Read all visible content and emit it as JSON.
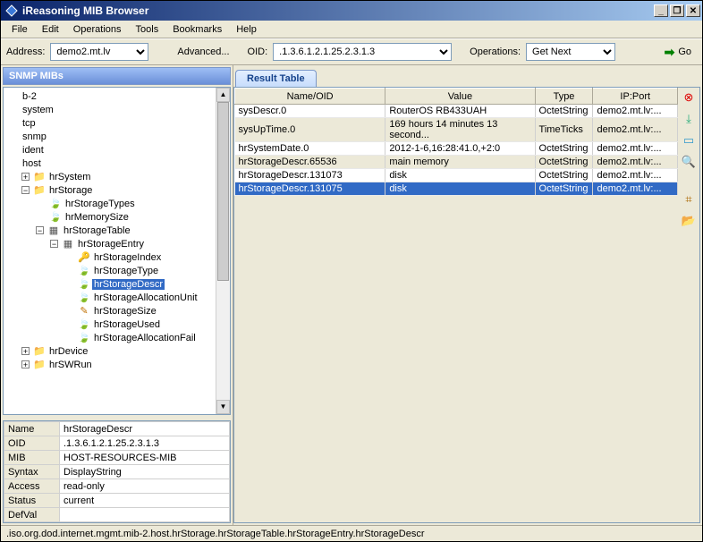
{
  "window": {
    "title": "iReasoning MIB Browser"
  },
  "menu": [
    "File",
    "Edit",
    "Operations",
    "Tools",
    "Bookmarks",
    "Help"
  ],
  "toolbar": {
    "address_label": "Address:",
    "address_value": "demo2.mt.lv",
    "advanced_label": "Advanced...",
    "oid_label": "OID:",
    "oid_value": ".1.3.6.1.2.1.25.2.3.1.3",
    "operations_label": "Operations:",
    "operations_value": "Get Next",
    "go_label": "Go"
  },
  "left": {
    "header": "SNMP MIBs",
    "tree": [
      {
        "depth": 0,
        "exp": "",
        "icon": "",
        "label": "b-2"
      },
      {
        "depth": 0,
        "exp": "",
        "icon": "",
        "label": "system"
      },
      {
        "depth": 0,
        "exp": "",
        "icon": "",
        "label": "tcp"
      },
      {
        "depth": 0,
        "exp": "",
        "icon": "",
        "label": "snmp"
      },
      {
        "depth": 0,
        "exp": "",
        "icon": "",
        "label": "ident"
      },
      {
        "depth": 0,
        "exp": "",
        "icon": "",
        "label": "host"
      },
      {
        "depth": 1,
        "exp": "+",
        "icon": "folder",
        "label": "hrSystem"
      },
      {
        "depth": 1,
        "exp": "-",
        "icon": "folder",
        "label": "hrStorage"
      },
      {
        "depth": 2,
        "exp": "",
        "icon": "leaf",
        "label": "hrStorageTypes"
      },
      {
        "depth": 2,
        "exp": "",
        "icon": "leaf",
        "label": "hrMemorySize"
      },
      {
        "depth": 2,
        "exp": "-",
        "icon": "table",
        "label": "hrStorageTable"
      },
      {
        "depth": 3,
        "exp": "-",
        "icon": "table",
        "label": "hrStorageEntry"
      },
      {
        "depth": 4,
        "exp": "",
        "icon": "key",
        "label": "hrStorageIndex"
      },
      {
        "depth": 4,
        "exp": "",
        "icon": "leaf",
        "label": "hrStorageType"
      },
      {
        "depth": 4,
        "exp": "",
        "icon": "leaf",
        "label": "hrStorageDescr",
        "selected": true
      },
      {
        "depth": 4,
        "exp": "",
        "icon": "leaf",
        "label": "hrStorageAllocationUnit"
      },
      {
        "depth": 4,
        "exp": "",
        "icon": "pencil",
        "label": "hrStorageSize"
      },
      {
        "depth": 4,
        "exp": "",
        "icon": "leaf",
        "label": "hrStorageUsed"
      },
      {
        "depth": 4,
        "exp": "",
        "icon": "leaf",
        "label": "hrStorageAllocationFail"
      },
      {
        "depth": 1,
        "exp": "+",
        "icon": "folder",
        "label": "hrDevice"
      },
      {
        "depth": 1,
        "exp": "+",
        "icon": "folder",
        "label": "hrSWRun"
      }
    ],
    "props": [
      [
        "Name",
        "hrStorageDescr"
      ],
      [
        "OID",
        ".1.3.6.1.2.1.25.2.3.1.3"
      ],
      [
        "MIB",
        "HOST-RESOURCES-MIB"
      ],
      [
        "Syntax",
        "DisplayString"
      ],
      [
        "Access",
        "read-only"
      ],
      [
        "Status",
        "current"
      ],
      [
        "DefVal",
        ""
      ]
    ]
  },
  "result": {
    "tab": "Result Table",
    "columns": [
      "Name/OID",
      "Value",
      "Type",
      "IP:Port"
    ],
    "rows": [
      {
        "cells": [
          "sysDescr.0",
          "RouterOS RB433UAH",
          "OctetString",
          "demo2.mt.lv:..."
        ]
      },
      {
        "cells": [
          "sysUpTime.0",
          "169 hours 14 minutes 13 second...",
          "TimeTicks",
          "demo2.mt.lv:..."
        ],
        "alt": true
      },
      {
        "cells": [
          "hrSystemDate.0",
          "2012-1-6,16:28:41.0,+2:0",
          "OctetString",
          "demo2.mt.lv:..."
        ]
      },
      {
        "cells": [
          "hrStorageDescr.65536",
          "main memory",
          "OctetString",
          "demo2.mt.lv:..."
        ],
        "alt": true
      },
      {
        "cells": [
          "hrStorageDescr.131073",
          "disk",
          "OctetString",
          "demo2.mt.lv:..."
        ]
      },
      {
        "cells": [
          "hrStorageDescr.131075",
          "disk",
          "OctetString",
          "demo2.mt.lv:..."
        ],
        "sel": true
      }
    ]
  },
  "status": ".iso.org.dod.internet.mgmt.mib-2.host.hrStorage.hrStorageTable.hrStorageEntry.hrStorageDescr"
}
